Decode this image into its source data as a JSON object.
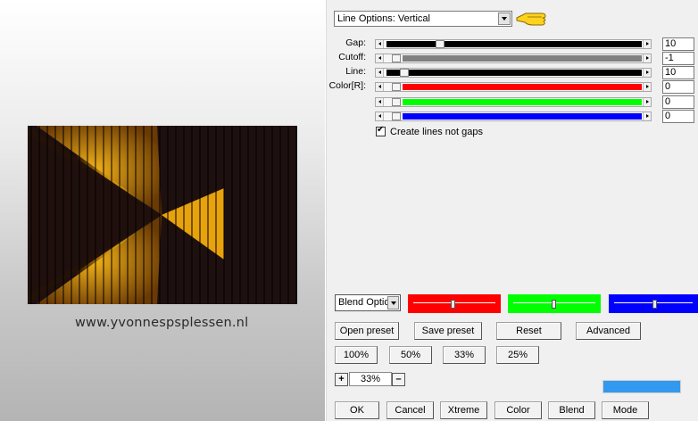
{
  "preview": {
    "watermark": "www.yvonnespsplessen.nl",
    "colors": {
      "background": "#1f1010",
      "accent": "#e8a20a",
      "lines": "#000000"
    }
  },
  "line_options": {
    "selected": "Line Options: Vertical",
    "pointer_icon": "pointing-hand-icon"
  },
  "sliders": [
    {
      "label": "Gap:",
      "value": "10",
      "track_color": "#000000"
    },
    {
      "label": "Cutoff:",
      "value": "-1",
      "track_color": "#808080"
    },
    {
      "label": "Line:",
      "value": "10",
      "track_color": "#000000"
    },
    {
      "label": "Color[R]:",
      "value": "0",
      "track_color": "#ff0000"
    },
    {
      "label": "",
      "value": "0",
      "track_color": "#00ff00"
    },
    {
      "label": "",
      "value": "0",
      "track_color": "#0000ff"
    }
  ],
  "create_lines_checkbox": {
    "label": "Create lines not gaps",
    "checked": true
  },
  "blend": {
    "dropdown": "Blend Options",
    "swatches": [
      "#ff0000",
      "#00ff00",
      "#0000ff"
    ]
  },
  "preset_buttons": {
    "open": "Open preset",
    "save": "Save preset",
    "reset": "Reset",
    "advanced": "Advanced"
  },
  "zoom_buttons": [
    "100%",
    "50%",
    "33%",
    "25%"
  ],
  "zoom": {
    "plus": "+",
    "value": "33%",
    "minus": "–"
  },
  "bottom_buttons": [
    "OK",
    "Cancel",
    "Xtreme",
    "Color",
    "Blend",
    "Mode"
  ],
  "status_color": "#3399ee"
}
